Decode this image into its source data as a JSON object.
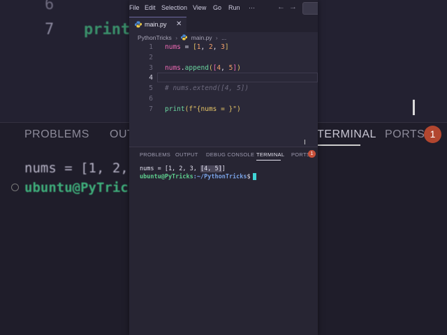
{
  "background": {
    "line6_number": "6",
    "line7_number": "7",
    "line7_code": "print",
    "panel_tabs": [
      "PROBLEMS",
      "OUT",
      "TERMINAL",
      "PORTS"
    ],
    "ports_badge": "1",
    "terminal_line1": "nums = [1, 2,",
    "terminal_line2": "ubuntu@PyTrick"
  },
  "menubar": {
    "items": [
      "File",
      "Edit",
      "Selection",
      "View",
      "Go",
      "Run",
      "···"
    ],
    "back_glyph": "←",
    "forward_glyph": "→"
  },
  "tab": {
    "label": "main.py",
    "close_glyph": "✕"
  },
  "breadcrumb": {
    "folder": "PythonTricks",
    "file": "main.py",
    "ellipsis": "..."
  },
  "editor": {
    "line_numbers": [
      "1",
      "2",
      "3",
      "4",
      "5",
      "6",
      "7"
    ],
    "active_line": "4",
    "line1": {
      "var": "nums",
      "op": " = ",
      "open": "[",
      "n1": "1",
      "c1": ", ",
      "n2": "2",
      "c2": ", ",
      "n3": "3"
    },
    "line3": {
      "var": "nums",
      "dot": ".",
      "fn": "append",
      "open": "(",
      "lb": "[",
      "n1": "4",
      "c1": ", ",
      "n2": "5",
      "rb": "]",
      "close": ")"
    },
    "line5_comment": "# nums.extend([4, 5])",
    "line7": {
      "fn": "print",
      "open": "(",
      "str": "f\"{nums = }\"",
      "close": ")"
    }
  },
  "panel": {
    "tabs": {
      "problems": "PROBLEMS",
      "output": "OUTPUT",
      "debug": "DEBUG CONSOLE",
      "terminal": "TERMINAL",
      "ports": "PORTS"
    },
    "ports_badge": "1",
    "terminal": {
      "line1_prefix": "nums = [1, 2, 3, ",
      "line1_highlight": "[4, 5]",
      "line1_suffix": "]",
      "host": "ubuntu@PyTricks",
      "path": ":~/PythonTricks",
      "dollar": "$"
    }
  }
}
